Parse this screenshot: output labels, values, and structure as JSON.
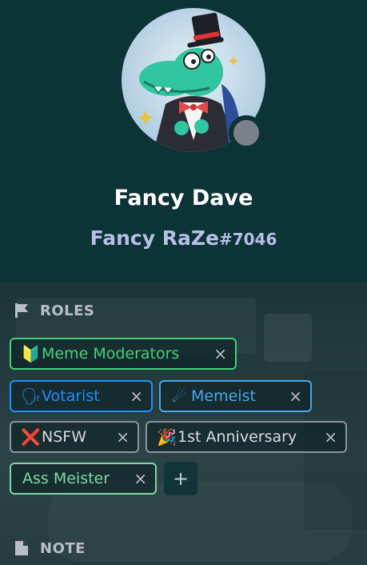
{
  "profile": {
    "display_name": "Fancy Dave",
    "username": "Fancy RaZe",
    "discriminator": "#7046",
    "status": "offline"
  },
  "sections": {
    "roles_title": "ROLES",
    "note_title": "NOTE"
  },
  "roles": [
    {
      "emoji": "🔰",
      "name": "Meme Moderators",
      "remove": "×",
      "color": "#43d17a"
    },
    {
      "emoji": "🗣",
      "name": "Votarist",
      "remove": "×",
      "color": "#1e8fff"
    },
    {
      "emoji": "☄",
      "name": "Memeist",
      "remove": "×",
      "color": "#4aa6e8"
    },
    {
      "emoji": "❌",
      "name": "NSFW",
      "remove": "×",
      "color": "#d7dadf"
    },
    {
      "emoji": "🎉",
      "name": "1st Anniversary",
      "remove": "×",
      "color": "#d7dadf"
    },
    {
      "emoji": "",
      "name": "Ass Meister",
      "remove": "×",
      "color": "#7fd6a6"
    }
  ],
  "add_role_label": "+"
}
